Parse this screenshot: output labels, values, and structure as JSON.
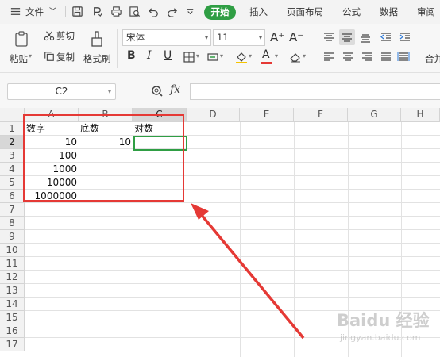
{
  "menu": {
    "file": "文件",
    "tabs": [
      "开始",
      "插入",
      "页面布局",
      "公式",
      "数据",
      "审阅"
    ]
  },
  "ribbon": {
    "paste": "粘贴",
    "cut": "剪切",
    "copy": "复制",
    "format_painter": "格式刷",
    "font_name": "宋体",
    "font_size": "11",
    "increase_font": "A⁺",
    "decrease_font": "A⁻",
    "bold": "B",
    "italic": "I",
    "underline": "U",
    "font_color_letter": "A",
    "merge_label": "合并"
  },
  "formula_bar": {
    "name_box": "C2",
    "fx": "fx",
    "formula": ""
  },
  "sheet": {
    "columns": [
      "A",
      "B",
      "C",
      "D",
      "E",
      "F",
      "G",
      "H"
    ],
    "active_column": "C",
    "rows": [
      "1",
      "2",
      "3",
      "4",
      "5",
      "6",
      "7",
      "8",
      "9",
      "10",
      "11",
      "12",
      "13",
      "14",
      "15",
      "16",
      "17"
    ],
    "active_row": "2",
    "cells": {
      "A1": "数字",
      "B1": "底数",
      "C1": "对数",
      "A2": "10",
      "B2": "10",
      "A3": "100",
      "A4": "1000",
      "A5": "10000",
      "A6": "1000000"
    },
    "selected_cell": "C2"
  },
  "watermark": {
    "brand": "Baidu 经验",
    "sub": "jingyan.baidu.com"
  },
  "colors": {
    "accent_green": "#2f9e44",
    "annotation_red": "#e53935"
  }
}
